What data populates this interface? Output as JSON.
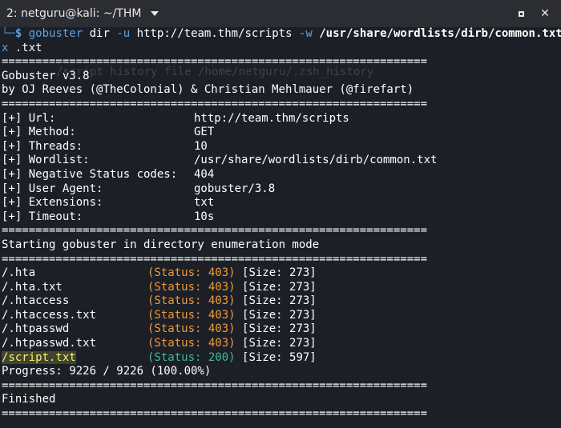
{
  "window": {
    "title": "2: netguru@kali: ~/THM",
    "maximize_icon": "maximize-icon",
    "close_icon": "close-icon"
  },
  "prompt": {
    "corner": "└─",
    "dollar": "$",
    "command": "gobuster",
    "subcommand": "dir",
    "url_flag": "-u",
    "url": "http://team.thm/scripts",
    "wordlist_flag": "-w",
    "wordlist": "/usr/share/wordlists/dirb/common.txt",
    "ext_flag": "x",
    "ext": ".txt"
  },
  "ghost_text": "/script history file /home/netguru/.zsh_history",
  "separator": "===============================================================",
  "banner": {
    "version": "Gobuster v3.8",
    "authors": "by OJ Reeves (@TheColonial) & Christian Mehlmauer (@firefart)"
  },
  "config": [
    {
      "key": "[+] Url:",
      "value": "http://team.thm/scripts"
    },
    {
      "key": "[+] Method:",
      "value": "GET"
    },
    {
      "key": "[+] Threads:",
      "value": "10"
    },
    {
      "key": "[+] Wordlist:",
      "value": "/usr/share/wordlists/dirb/common.txt"
    },
    {
      "key": "[+] Negative Status codes:",
      "value": "404"
    },
    {
      "key": "[+] User Agent:",
      "value": "gobuster/3.8"
    },
    {
      "key": "[+] Extensions:",
      "value": "txt"
    },
    {
      "key": "[+] Timeout:",
      "value": "10s"
    }
  ],
  "start_message": "Starting gobuster in directory enumeration mode",
  "results": [
    {
      "path": "/.hta",
      "status": "(Status: 403)",
      "size": "[Size: 273]",
      "code": "403"
    },
    {
      "path": "/.hta.txt",
      "status": "(Status: 403)",
      "size": "[Size: 273]",
      "code": "403"
    },
    {
      "path": "/.htaccess",
      "status": "(Status: 403)",
      "size": "[Size: 273]",
      "code": "403"
    },
    {
      "path": "/.htaccess.txt",
      "status": "(Status: 403)",
      "size": "[Size: 273]",
      "code": "403"
    },
    {
      "path": "/.htpasswd",
      "status": "(Status: 403)",
      "size": "[Size: 273]",
      "code": "403"
    },
    {
      "path": "/.htpasswd.txt",
      "status": "(Status: 403)",
      "size": "[Size: 273]",
      "code": "403"
    },
    {
      "path": "/script.txt",
      "status": "(Status: 200)",
      "size": "[Size: 597]",
      "code": "200"
    }
  ],
  "progress": "Progress: 9226 / 9226 (100.00%)",
  "finished": "Finished",
  "colors": {
    "background": "#1c1f26",
    "titlebar": "#2b2d33",
    "prompt_blue": "#5aa3e8",
    "status_403": "#ef9a3c",
    "status_200": "#3fb8a0",
    "highlight": "#f3f06a"
  }
}
